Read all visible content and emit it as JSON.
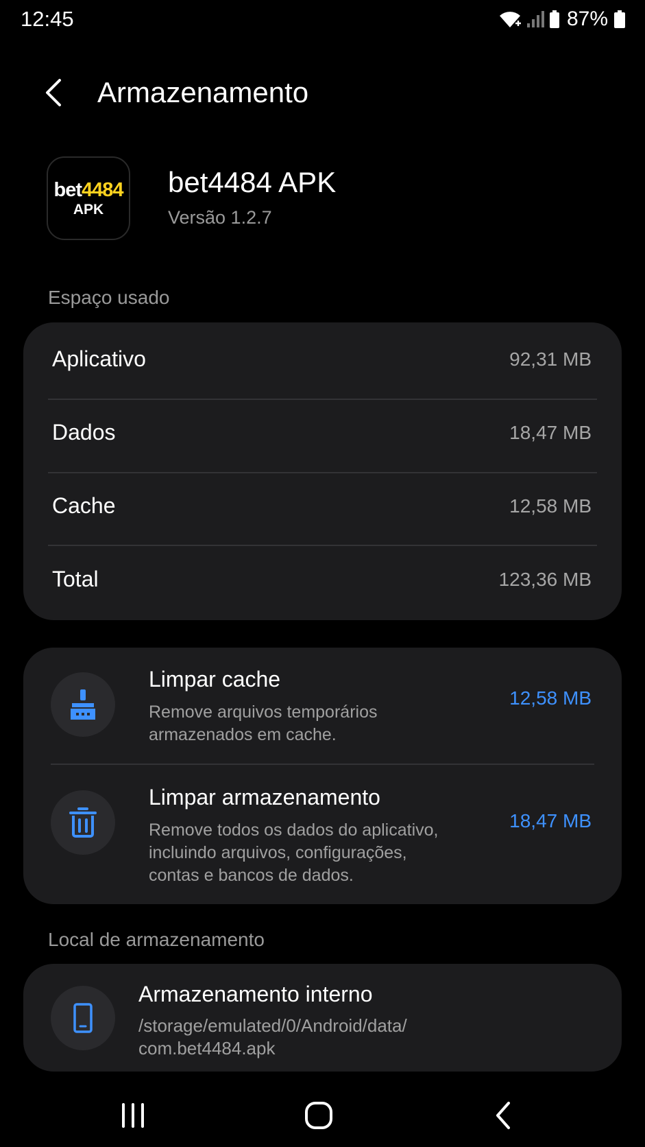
{
  "status_bar": {
    "time": "12:45",
    "battery": "87%"
  },
  "header": {
    "title": "Armazenamento"
  },
  "app": {
    "icon_text_white": "bet",
    "icon_text_yellow": "4484",
    "icon_text_bottom": "APK",
    "name": "bet4484 APK",
    "version": "Versão 1.2.7"
  },
  "space_used": {
    "section_label": "Espaço usado",
    "rows": [
      {
        "label": "Aplicativo",
        "value": "92,31 MB"
      },
      {
        "label": "Dados",
        "value": "18,47 MB"
      },
      {
        "label": "Cache",
        "value": "12,58 MB"
      },
      {
        "label": "Total",
        "value": "123,36 MB"
      }
    ]
  },
  "actions": {
    "clear_cache": {
      "title": "Limpar cache",
      "desc_line1": "Remove arquivos temporários",
      "desc_line2": "armazenados em cache.",
      "value": "12,58 MB"
    },
    "clear_storage": {
      "title": "Limpar armazenamento",
      "desc_line1": "Remove todos os dados do aplicativo,",
      "desc_line2": "incluindo arquivos, configurações,",
      "desc_line3": "contas e bancos de dados.",
      "value": "18,47 MB"
    }
  },
  "location": {
    "section_label": "Local de armazenamento",
    "title": "Armazenamento interno",
    "path_line1": "/storage/emulated/0/Android/data/",
    "path_line2": "com.bet4484.apk"
  },
  "colors": {
    "background": "#000000",
    "card": "#1c1c1e",
    "accent": "#3e91ff",
    "logo_yellow": "#ffd21f"
  },
  "icons": {
    "back": "chevron-left-icon",
    "clear_cache": "broom-icon",
    "clear_storage": "trash-icon",
    "location": "phone-icon",
    "nav_recents": "recents-icon",
    "nav_home": "home-icon",
    "nav_back": "back-icon"
  }
}
